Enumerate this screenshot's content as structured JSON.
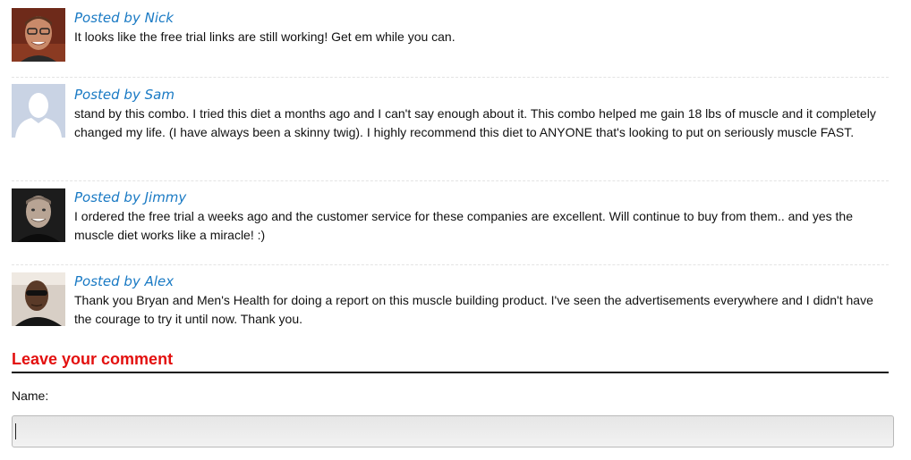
{
  "comments": [
    {
      "author": "Posted by Nick",
      "avatar_icon": "nick-photo",
      "text": "It looks like the free trial links are still working! Get em while you can."
    },
    {
      "author": "Posted by Sam",
      "avatar_icon": "default-user-silhouette",
      "text": "stand by this combo. I tried this diet a months ago and I can't say enough about it. This combo helped me gain 18 lbs of muscle and it completely changed my life. (I have always been a skinny twig). I highly recommend this diet to ANYONE that's looking to put on seriously muscle FAST."
    },
    {
      "author": "Posted by Jimmy",
      "avatar_icon": "jimmy-photo",
      "text": "I ordered the free trial a weeks ago and the customer service for these companies are excellent. Will continue to buy from them.. and yes the muscle diet works like a miracle! :)"
    },
    {
      "author": "Posted by Alex",
      "avatar_icon": "alex-photo",
      "text": "Thank you Bryan and Men's Health for doing a report on this muscle building product. I've seen the advertisements everywhere and I didn't have the courage to try it until now. Thank you."
    }
  ],
  "form": {
    "title": "Leave your comment",
    "name_label": "Name:",
    "name_value": ""
  },
  "colors": {
    "author_link": "#1a7ac4",
    "form_title": "#e3100f"
  }
}
